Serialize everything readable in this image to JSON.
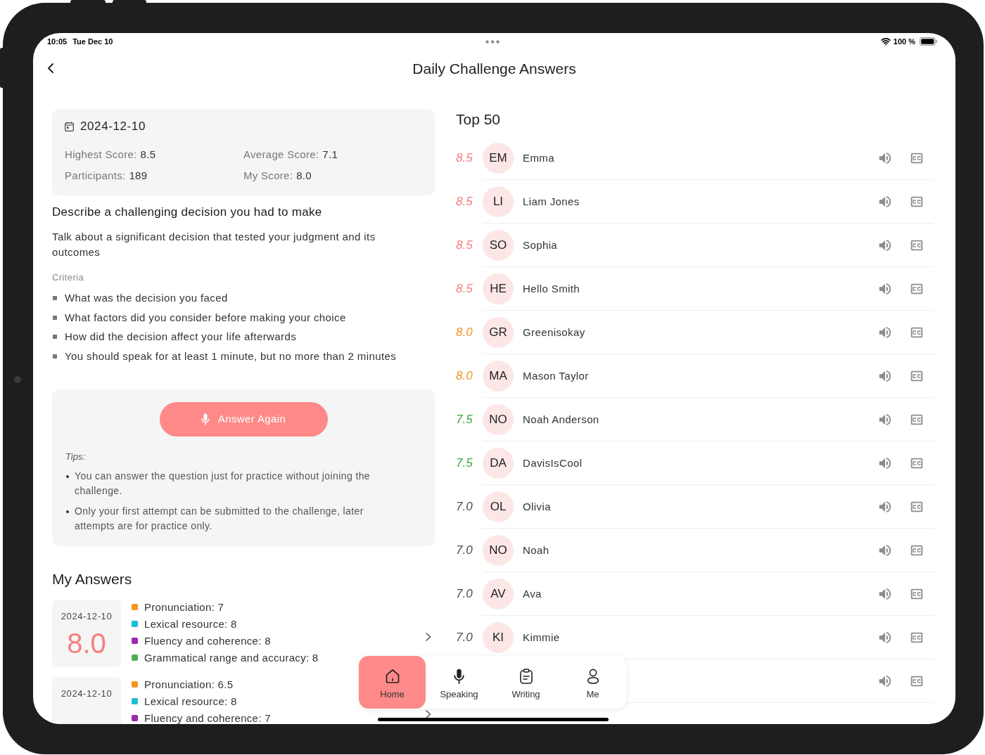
{
  "status_bar": {
    "time": "10:05",
    "date": "Tue Dec 10",
    "battery": "100 %"
  },
  "nav": {
    "title": "Daily Challenge Answers"
  },
  "summary": {
    "date": "2024-12-10",
    "stats": [
      {
        "label": "Highest Score:",
        "value": "8.5"
      },
      {
        "label": "Average Score:",
        "value": "7.1"
      },
      {
        "label": "Participants:",
        "value": "189"
      },
      {
        "label": "My Score:",
        "value": "8.0"
      }
    ]
  },
  "question": {
    "title": "Describe a challenging decision you had to make",
    "description": "Talk about a significant decision that tested your judgment and its outcomes",
    "criteria_label": "Criteria",
    "criteria": [
      "What was the decision you faced",
      "What factors did you consider before making your choice",
      "How did the decision affect your life afterwards",
      "You should speak for at least 1 minute, but no more than 2 minutes"
    ]
  },
  "practice": {
    "button": "Answer Again",
    "tips_label": "Tips:",
    "tips": [
      "You can answer the question just for practice without joining the challenge.",
      "Only your first attempt can be submitted to the challenge, later attempts are for practice only."
    ]
  },
  "my_answers": {
    "title": "My Answers",
    "answers": [
      {
        "date": "2024-12-10",
        "score": "8.0",
        "scores": [
          {
            "label": "Pronunciation: 7",
            "color": "#f7931e"
          },
          {
            "label": "Lexical resource: 8",
            "color": "#1fbcd2"
          },
          {
            "label": "Fluency and coherence: 8",
            "color": "#9c27b0"
          },
          {
            "label": "Grammatical range and accuracy: 8",
            "color": "#4caf50"
          }
        ]
      },
      {
        "date": "2024-12-10",
        "scores": [
          {
            "label": "Pronunciation: 6.5",
            "color": "#f7931e"
          },
          {
            "label": "Lexical resource: 8",
            "color": "#1fbcd2"
          },
          {
            "label": "Fluency and coherence: 7",
            "color": "#9c27b0"
          }
        ]
      }
    ]
  },
  "top50": {
    "title": "Top 50",
    "rows": [
      {
        "kind": "entry",
        "score": "8.5",
        "color": "#f47c7c",
        "initials": "EM",
        "name": "Emma"
      },
      {
        "kind": "entry",
        "score": "8.5",
        "color": "#f47c7c",
        "initials": "LI",
        "name": "Liam Jones"
      },
      {
        "kind": "entry",
        "score": "8.5",
        "color": "#f47c7c",
        "initials": "SO",
        "name": "Sophia"
      },
      {
        "kind": "entry",
        "score": "8.5",
        "color": "#f47c7c",
        "initials": "HE",
        "name": "Hello Smith"
      },
      {
        "kind": "entry",
        "score": "8.0",
        "color": "#f7931e",
        "initials": "GR",
        "name": "Greenisokay"
      },
      {
        "kind": "entry",
        "score": "8.0",
        "color": "#f7931e",
        "initials": "MA",
        "name": "Mason Taylor"
      },
      {
        "kind": "entry",
        "score": "7.5",
        "color": "#3fa63f",
        "initials": "NO",
        "name": "Noah Anderson"
      },
      {
        "kind": "entry",
        "score": "7.5",
        "color": "#3fa63f",
        "initials": "DA",
        "name": "DavisIsCool"
      },
      {
        "kind": "entry",
        "score": "7.0",
        "color": "#4d4d4d",
        "initials": "OL",
        "name": "Olivia"
      },
      {
        "kind": "entry",
        "score": "7.0",
        "color": "#4d4d4d",
        "initials": "NO",
        "name": "Noah"
      },
      {
        "kind": "entry",
        "score": "7.0",
        "color": "#4d4d4d",
        "initials": "AV",
        "name": "Ava"
      },
      {
        "kind": "entry",
        "score": "7.0",
        "color": "#4d4d4d",
        "initials": "KI",
        "name": "Kimmie"
      },
      {
        "kind": "covered"
      }
    ]
  },
  "tab_bar": {
    "tabs": [
      {
        "label": "Home",
        "selected": true
      },
      {
        "label": "Speaking",
        "selected": false
      },
      {
        "label": "Writing",
        "selected": false
      },
      {
        "label": "Me",
        "selected": false
      }
    ]
  }
}
